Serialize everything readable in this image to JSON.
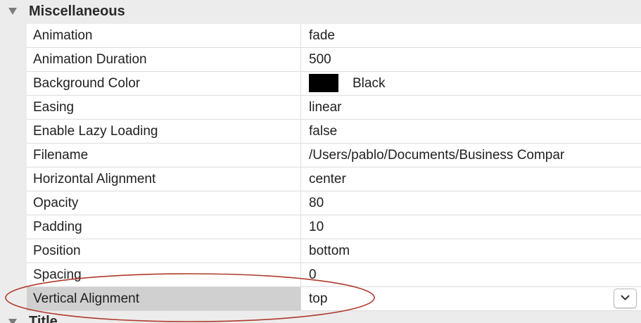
{
  "section": {
    "title": "Miscellaneous",
    "disclosure_icon": "disclosure-triangle-down"
  },
  "properties": [
    {
      "name": "Animation",
      "value": "fade"
    },
    {
      "name": "Animation Duration",
      "value": "500"
    },
    {
      "name": "Background Color",
      "value": "Black",
      "swatch_color": "#000000"
    },
    {
      "name": "Easing",
      "value": "linear"
    },
    {
      "name": "Enable Lazy Loading",
      "value": "false"
    },
    {
      "name": "Filename",
      "value": "/Users/pablo/Documents/Business Compar"
    },
    {
      "name": "Horizontal Alignment",
      "value": "center"
    },
    {
      "name": "Opacity",
      "value": "80"
    },
    {
      "name": "Padding",
      "value": "10"
    },
    {
      "name": "Position",
      "value": "bottom"
    },
    {
      "name": "Spacing",
      "value": "0"
    },
    {
      "name": "Vertical Alignment",
      "value": "top",
      "selected": true,
      "has_dropdown": true
    }
  ],
  "next_section": {
    "title": "Title"
  },
  "annotation": {
    "shape": "ellipse",
    "color": "#b03a2e"
  },
  "colors": {
    "background": "#ececec",
    "row_background": "#ffffff",
    "selected_row": "#d0d0d0",
    "grid_line": "#dcdcdc"
  }
}
